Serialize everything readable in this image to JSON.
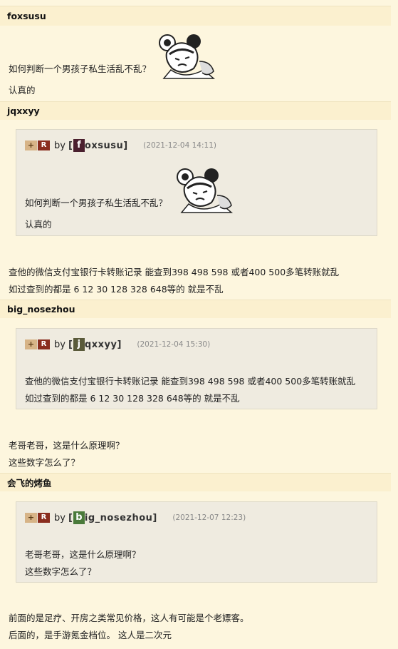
{
  "posts": [
    {
      "author": "foxsusu",
      "lines": [
        "如何判断一个男孩子私生活乱不乱？",
        "认真的"
      ]
    },
    {
      "author": "jqxxyy",
      "quote": {
        "plus": "+",
        "r": "R",
        "by": "by",
        "avatar_letter": "f",
        "username": "oxsusu",
        "time": "(2021-12-04 14:11)",
        "lines": [
          "如何判断一个男孩子私生活乱不乱？",
          "认真的"
        ]
      },
      "lines": [
        "查他的微信支付宝银行卡转账记录 能查到398 498 598 或者400 500多笔转账就乱",
        "如过查到的都是 6 12 30 128 328 648等的 就是不乱"
      ]
    },
    {
      "author": "big_nosezhou",
      "quote": {
        "plus": "+",
        "r": "R",
        "by": "by",
        "avatar_letter": "j",
        "username": "qxxyy",
        "time": "(2021-12-04 15:30)",
        "lines": [
          "查他的微信支付宝银行卡转账记录 能查到398 498 598 或者400 500多笔转账就乱",
          "如过查到的都是 6 12 30 128 328 648等的 就是不乱"
        ]
      },
      "lines": [
        "老哥老哥，这是什么原理啊？",
        "这些数字怎么了？"
      ]
    },
    {
      "author": "会飞的烤鱼",
      "quote": {
        "plus": "+",
        "r": "R",
        "by": "by",
        "avatar_letter": "b",
        "username": "ig_nosezhou",
        "time": "(2021-12-07 12:23)",
        "lines": [
          "老哥老哥，这是什么原理啊？",
          "这些数字怎么了？"
        ]
      },
      "lines": [
        "前面的是足疗、开房之类常见价格，这人有可能是个老嫖客。",
        "后面的，是手游氪金档位。 这人是二次元"
      ]
    }
  ],
  "colors": {
    "avatar_f": "#4a1f2e",
    "avatar_j": "#5a5a3a",
    "avatar_b": "#4a7a3a"
  },
  "icons": [
    "manga-girl-sticker"
  ]
}
